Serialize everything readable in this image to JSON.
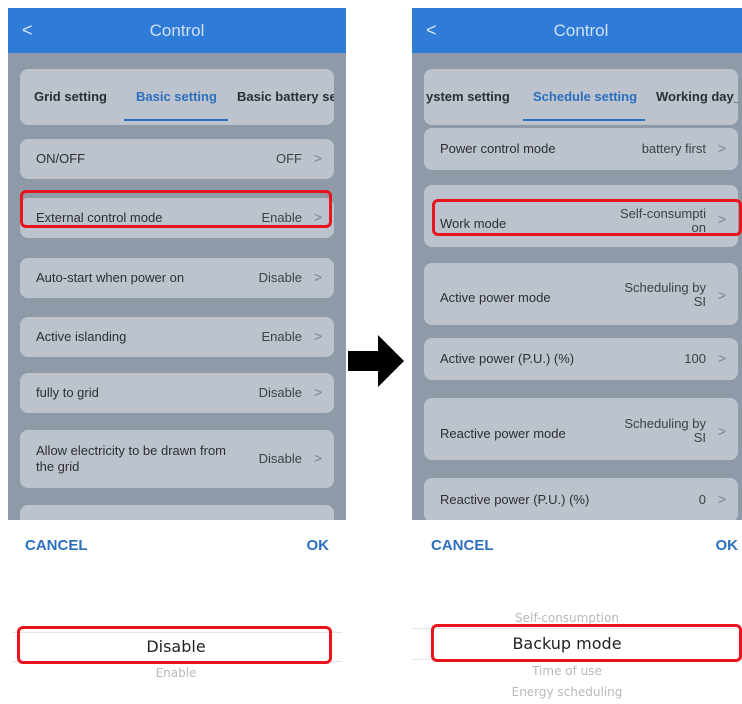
{
  "left_screen": {
    "title": "Control",
    "tabs": [
      "Grid setting",
      "Basic setting",
      "Basic battery sett"
    ],
    "active_tab": "Basic setting",
    "rows": [
      {
        "label": "ON/OFF",
        "value": "OFF"
      },
      {
        "label": "External control mode",
        "value": "Enable"
      },
      {
        "label": "Auto-start when power on",
        "value": "Disable"
      },
      {
        "label": "Active islanding",
        "value": "Enable"
      },
      {
        "label": "fully to grid",
        "value": "Disable"
      },
      {
        "label": "Allow electricity to be drawn from the grid",
        "value": "Disable"
      }
    ],
    "cancel": "CANCEL",
    "ok": "OK"
  },
  "right_screen": {
    "title": "Control",
    "tabs": [
      "ystem setting",
      "Schedule setting",
      "Working day_"
    ],
    "active_tab": "Schedule setting",
    "rows": [
      {
        "label": "Power control mode",
        "value": "battery first"
      },
      {
        "label": "Work mode",
        "value": "Self-consumpti on"
      },
      {
        "label": "Active power mode",
        "value": "Scheduling by SI"
      },
      {
        "label": "Active power (P.U.) (%)",
        "value": "100"
      },
      {
        "label": "Reactive power mode",
        "value": "Scheduling by SI"
      },
      {
        "label": "Reactive power (P.U.) (%)",
        "value": "0"
      }
    ],
    "cancel": "CANCEL",
    "ok": "OK"
  },
  "left_picker": {
    "selected": "Disable",
    "after": [
      "Enable"
    ]
  },
  "right_picker": {
    "before": [
      "Self-consumption"
    ],
    "selected": "Backup mode",
    "after": [
      "Time of use",
      "Energy scheduling"
    ]
  },
  "icons": {
    "back": "chevron-left-icon",
    "row_chevron": "chevron-right-icon",
    "transition": "arrow-right-icon"
  },
  "colors": {
    "appbar": "#2f7bd8",
    "accent": "#2c6fbf",
    "highlight": "#e8141e"
  }
}
